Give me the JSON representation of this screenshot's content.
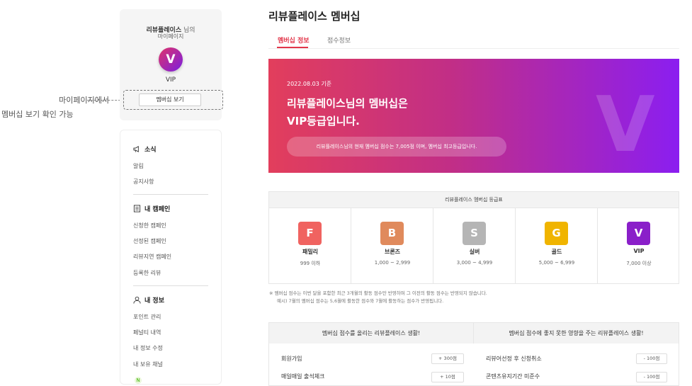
{
  "annotation": {
    "line1": "마이페이지에서",
    "line2": "멤버십 보기 확인 가능"
  },
  "profile": {
    "name": "리뷰플레이스",
    "name_suffix": " 님의",
    "subtitle": "마이페이지",
    "badge_letter": "V",
    "grade": "VIP",
    "button": "멤버십 보기"
  },
  "menu": {
    "news": {
      "header": "소식",
      "items": [
        "알림",
        "공지사항"
      ]
    },
    "campaign": {
      "header": "내 캠페인",
      "items": [
        "신청한 캠페인",
        "선정된 캠페인",
        "리뷰지연 캠페인",
        "등록한 리뷰"
      ]
    },
    "info": {
      "header": "내 정보",
      "items": [
        "포인트 관리",
        "페널티 내역",
        "내 정보 수정",
        "내 보유 채널"
      ]
    }
  },
  "header": {
    "title": "리뷰플레이스 멤버십",
    "tabs": [
      "멤버십 정보",
      "점수정보"
    ]
  },
  "banner": {
    "date": "2022.08.03 기준",
    "line1": "리뷰플레이스님의 멤버십은",
    "line2": "VIP등급입니다.",
    "pill": "리뷰플레이스님의 현재 멤버십 점수는 7,005점 이며, 멤버십 최고등급입니다.",
    "watermark": "V"
  },
  "grade_table": {
    "title": "리뷰플레이스 멤버십 등급표",
    "grades": [
      {
        "letter": "F",
        "name": "패밀리",
        "range": "999 이하",
        "color": "#f06360"
      },
      {
        "letter": "B",
        "name": "브론즈",
        "range": "1,000 ~ 2,999",
        "color": "#e08a5c"
      },
      {
        "letter": "S",
        "name": "실버",
        "range": "3,000 ~ 4,999",
        "color": "#b5b5b5"
      },
      {
        "letter": "G",
        "name": "골드",
        "range": "5,000 ~ 6,999",
        "color": "#f0b400"
      },
      {
        "letter": "V",
        "name": "VIP",
        "range": "7,000 이상",
        "color": "#8a1fc9"
      }
    ]
  },
  "notes": {
    "line1": "※ 멤버십 점수는 이번 달을 포함한 최근 3개월의 활동 점수만 반영하며 그 이전의 활동 점수는 반영되지 않습니다.",
    "line2": "예시) 7월의 멤버십 점수는 5,6월에 활동한 점수와 7월에 활동하는 점수가 반영됩니다."
  },
  "score_table": {
    "left_header": "멤버십 점수를 올리는 리뷰플레이스 생활!",
    "right_header": "멤버십 점수에 좋지 못한 영향을 주는 리뷰플레이스 생활!",
    "left_rows": [
      {
        "label": "회원가입",
        "points": "+ 300점"
      },
      {
        "label": "매일매일 출석체크",
        "points": "+ 10점"
      }
    ],
    "right_rows": [
      {
        "label": "리뷰어선정 후 신청취소",
        "points": "- 100점"
      },
      {
        "label": "콘텐츠유지기간 미준수",
        "points": "- 100점"
      }
    ]
  }
}
